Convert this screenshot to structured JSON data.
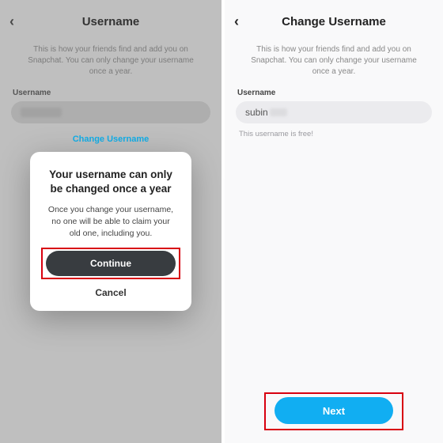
{
  "left": {
    "title": "Username",
    "subtext": "This is how your friends find and add you on Snapchat. You can only change your username once a year.",
    "field_label": "Username",
    "change_link": "Change Username",
    "modal": {
      "title": "Your username can only be changed once a year",
      "body": "Once you change your username, no one will be able to claim your old one, including you.",
      "continue": "Continue",
      "cancel": "Cancel"
    }
  },
  "right": {
    "title": "Change Username",
    "subtext": "This is how your friends find and add you on Snapchat. You can only change your username once a year.",
    "field_label": "Username",
    "input_value": "subin",
    "status": "This username is free!",
    "next": "Next"
  },
  "icons": {
    "back": "‹"
  }
}
